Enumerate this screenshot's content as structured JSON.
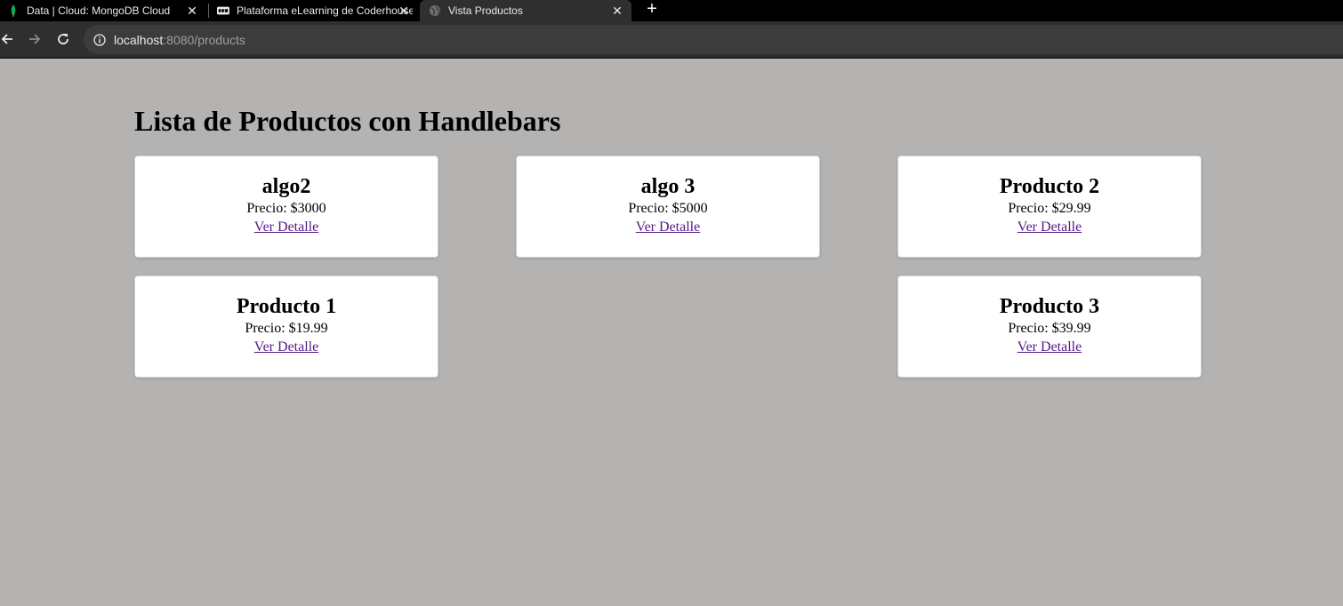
{
  "browser": {
    "tabs": [
      {
        "title": "Data | Cloud: MongoDB Cloud",
        "icon": "mongodb-leaf-icon",
        "active": false
      },
      {
        "title": "Plataforma eLearning de Coderhouse",
        "icon": "coderhouse-icon",
        "active": false
      },
      {
        "title": "Vista Productos",
        "icon": "globe-icon",
        "active": true
      }
    ],
    "address": {
      "host": "localhost",
      "path": ":8080/products"
    }
  },
  "page": {
    "title": "Lista de Productos con Handlebars",
    "price_prefix": "Precio: ",
    "products": [
      {
        "name": "algo2",
        "price": "Precio: $3000",
        "link": "Ver Detalle"
      },
      {
        "name": "algo 3",
        "price": "Precio: $5000",
        "link": "Ver Detalle"
      },
      {
        "name": "Producto 2",
        "price": "Precio: $29.99",
        "link": "Ver Detalle"
      },
      {
        "name": "Producto 1",
        "price": "Precio: $19.99",
        "link": "Ver Detalle"
      },
      {
        "name": "Producto 3",
        "price": "Precio: $39.99",
        "link": "Ver Detalle"
      }
    ]
  },
  "colors": {
    "page_background": "#b4b3b1",
    "card_background": "#ffffff",
    "visited_link": "#551a8b"
  }
}
